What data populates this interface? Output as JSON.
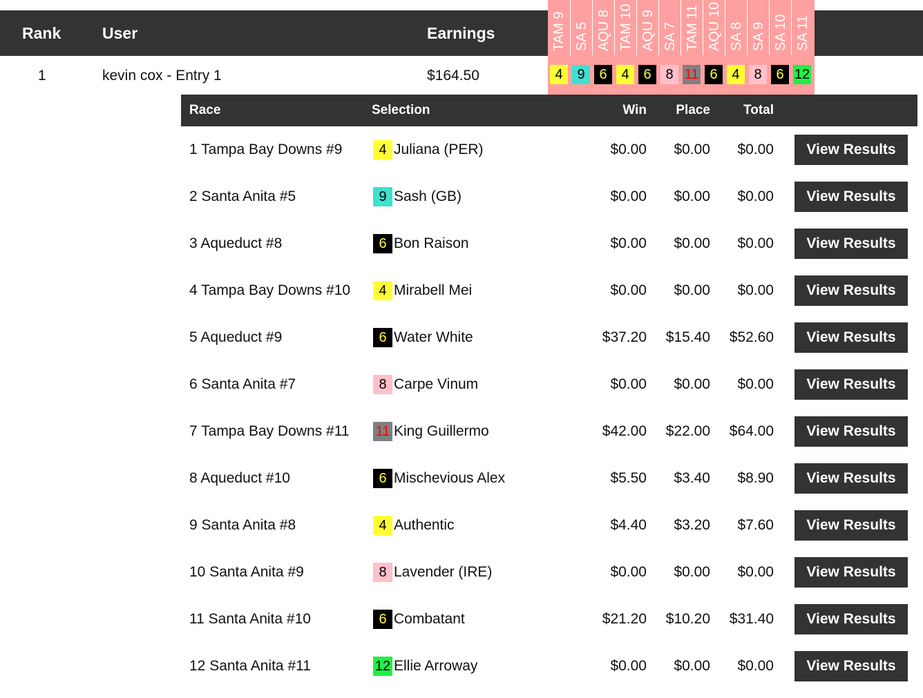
{
  "colors": {
    "header_bg": "#333333",
    "race_strip_bg": "#ffa0a0"
  },
  "header": {
    "rank": "Rank",
    "user": "User",
    "earnings": "Earnings"
  },
  "races": [
    {
      "label": "TAM 9",
      "pick": "4",
      "bg": "#ffff33",
      "fg": "#000000"
    },
    {
      "label": "SA 5",
      "pick": "9",
      "bg": "#40e0d0",
      "fg": "#000000"
    },
    {
      "label": "AQU 8",
      "pick": "6",
      "bg": "#000000",
      "fg": "#ffff33"
    },
    {
      "label": "TAM 10",
      "pick": "4",
      "bg": "#ffff33",
      "fg": "#000000"
    },
    {
      "label": "AQU 9",
      "pick": "6",
      "bg": "#000000",
      "fg": "#ffff33"
    },
    {
      "label": "SA 7",
      "pick": "8",
      "bg": "#ffc0cb",
      "fg": "#000000"
    },
    {
      "label": "TAM 11",
      "pick": "11",
      "bg": "#808080",
      "fg": "#ff0000"
    },
    {
      "label": "AQU 10",
      "pick": "6",
      "bg": "#000000",
      "fg": "#ffff33"
    },
    {
      "label": "SA 8",
      "pick": "4",
      "bg": "#ffff33",
      "fg": "#000000"
    },
    {
      "label": "SA 9",
      "pick": "8",
      "bg": "#ffc0cb",
      "fg": "#000000"
    },
    {
      "label": "SA 10",
      "pick": "6",
      "bg": "#000000",
      "fg": "#ffff33"
    },
    {
      "label": "SA 11",
      "pick": "12",
      "bg": "#22ee44",
      "fg": "#000000"
    }
  ],
  "leader": {
    "rank": "1",
    "user": "kevin cox - Entry 1",
    "earnings": "$164.50"
  },
  "detail": {
    "headers": {
      "race": "Race",
      "selection": "Selection",
      "win": "Win",
      "place": "Place",
      "total": "Total"
    },
    "button_label": "View Results",
    "rows": [
      {
        "race": "1 Tampa Bay Downs #9",
        "num": "4",
        "num_bg": "#ffff33",
        "num_fg": "#000000",
        "horse": "Juliana (PER)",
        "win": "$0.00",
        "place": "$0.00",
        "total": "$0.00"
      },
      {
        "race": "2 Santa Anita #5",
        "num": "9",
        "num_bg": "#40e0d0",
        "num_fg": "#000000",
        "horse": "Sash (GB)",
        "win": "$0.00",
        "place": "$0.00",
        "total": "$0.00"
      },
      {
        "race": "3 Aqueduct #8",
        "num": "6",
        "num_bg": "#000000",
        "num_fg": "#ffff33",
        "horse": "Bon Raison",
        "win": "$0.00",
        "place": "$0.00",
        "total": "$0.00"
      },
      {
        "race": "4 Tampa Bay Downs #10",
        "num": "4",
        "num_bg": "#ffff33",
        "num_fg": "#000000",
        "horse": "Mirabell Mei",
        "win": "$0.00",
        "place": "$0.00",
        "total": "$0.00"
      },
      {
        "race": "5 Aqueduct #9",
        "num": "6",
        "num_bg": "#000000",
        "num_fg": "#ffff33",
        "horse": "Water White",
        "win": "$37.20",
        "place": "$15.40",
        "total": "$52.60"
      },
      {
        "race": "6 Santa Anita #7",
        "num": "8",
        "num_bg": "#ffc0cb",
        "num_fg": "#000000",
        "horse": "Carpe Vinum",
        "win": "$0.00",
        "place": "$0.00",
        "total": "$0.00"
      },
      {
        "race": "7 Tampa Bay Downs #11",
        "num": "11",
        "num_bg": "#808080",
        "num_fg": "#ff0000",
        "horse": "King Guillermo",
        "win": "$42.00",
        "place": "$22.00",
        "total": "$64.00"
      },
      {
        "race": "8 Aqueduct #10",
        "num": "6",
        "num_bg": "#000000",
        "num_fg": "#ffff33",
        "horse": "Mischevious Alex",
        "win": "$5.50",
        "place": "$3.40",
        "total": "$8.90"
      },
      {
        "race": "9 Santa Anita #8",
        "num": "4",
        "num_bg": "#ffff33",
        "num_fg": "#000000",
        "horse": "Authentic",
        "win": "$4.40",
        "place": "$3.20",
        "total": "$7.60"
      },
      {
        "race": "10 Santa Anita #9",
        "num": "8",
        "num_bg": "#ffc0cb",
        "num_fg": "#000000",
        "horse": "Lavender (IRE)",
        "win": "$0.00",
        "place": "$0.00",
        "total": "$0.00"
      },
      {
        "race": "11 Santa Anita #10",
        "num": "6",
        "num_bg": "#000000",
        "num_fg": "#ffff33",
        "horse": "Combatant",
        "win": "$21.20",
        "place": "$10.20",
        "total": "$31.40"
      },
      {
        "race": "12 Santa Anita #11",
        "num": "12",
        "num_bg": "#22ee44",
        "num_fg": "#000000",
        "horse": "Ellie Arroway",
        "win": "$0.00",
        "place": "$0.00",
        "total": "$0.00"
      }
    ]
  }
}
